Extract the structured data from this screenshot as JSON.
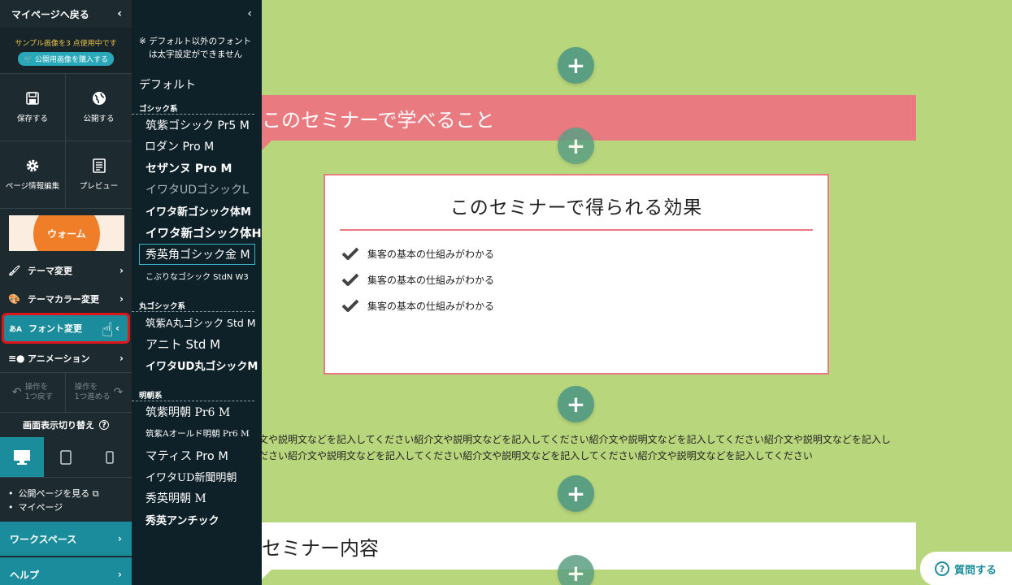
{
  "sidebar": {
    "back_label": "マイページへ戻る",
    "notice": "サンプル画像を3 点使用中です",
    "buy_label": "🛒 公開用画像を購入する",
    "save_label": "保存する",
    "publish_label": "公開する",
    "page_info_label": "ページ情報編集",
    "preview_label": "プレビュー",
    "theme_name": "ウォーム",
    "menu": {
      "theme_change": "テーマ変更",
      "theme_color": "テーマカラー変更",
      "font_change": "フォント変更",
      "animation": "アニメーション"
    },
    "undo_label_1": "操作を",
    "undo_label_2": "1つ戻す",
    "redo_label_1": "操作を",
    "redo_label_2": "1つ進める",
    "view_switch": "画面表示切り替え",
    "view_public": "公開ページを見る",
    "mypage": "マイページ",
    "workspace": "ワークスペース",
    "help": "ヘルプ"
  },
  "fontpanel": {
    "note_line1": "※ デフォルト以外のフォント",
    "note_line2": "は太字設定ができません",
    "default": "デフォルト",
    "cat_gothic": "ゴシック系",
    "gothic": [
      "筑紫ゴシック Pr5 M",
      "ロダン Pro M",
      "セザンヌ Pro M",
      "イワタUDゴシックL",
      "イワタ新ゴシック体M",
      "イワタ新ゴシック体H",
      "秀英角ゴシック金 M",
      "こぶりなゴシック StdN W3"
    ],
    "cat_maru": "丸ゴシック系",
    "maru": [
      "筑紫A丸ゴシック Std M",
      "アニト Std M",
      "イワタUD丸ゴシックM"
    ],
    "cat_mincho": "明朝系",
    "mincho": [
      "筑紫明朝 Pr6 M",
      "筑紫Aオールド明朝 Pr6 M",
      "マティス Pro M",
      "イワタUD新聞明朝",
      "秀英明朝 M",
      "秀英アンチック"
    ]
  },
  "canvas": {
    "heading1": "このセミナーで学べること",
    "card_title": "このセミナーで得られる効果",
    "checks": [
      "集客の基本の仕組みがわかる",
      "集客の基本の仕組みがわかる",
      "集客の基本の仕組みがわかる"
    ],
    "body_line1": "文や説明文などを記入してください紹介文や説明文などを記入してください紹介文や説明文などを記入してください紹介文や説明文などを記入し",
    "body_line2": "ださい紹介文や説明文などを記入してください紹介文や説明文などを記入してください紹介文や説明文などを記入してください",
    "heading2": "セミナー内容",
    "ask_label": "質問する"
  },
  "colors": {
    "background": "#b8d67c",
    "accent": "#e87a80",
    "sidebar": "#1d2a2f",
    "teal": "#1a8c9b",
    "plus": "#5b9f83"
  }
}
